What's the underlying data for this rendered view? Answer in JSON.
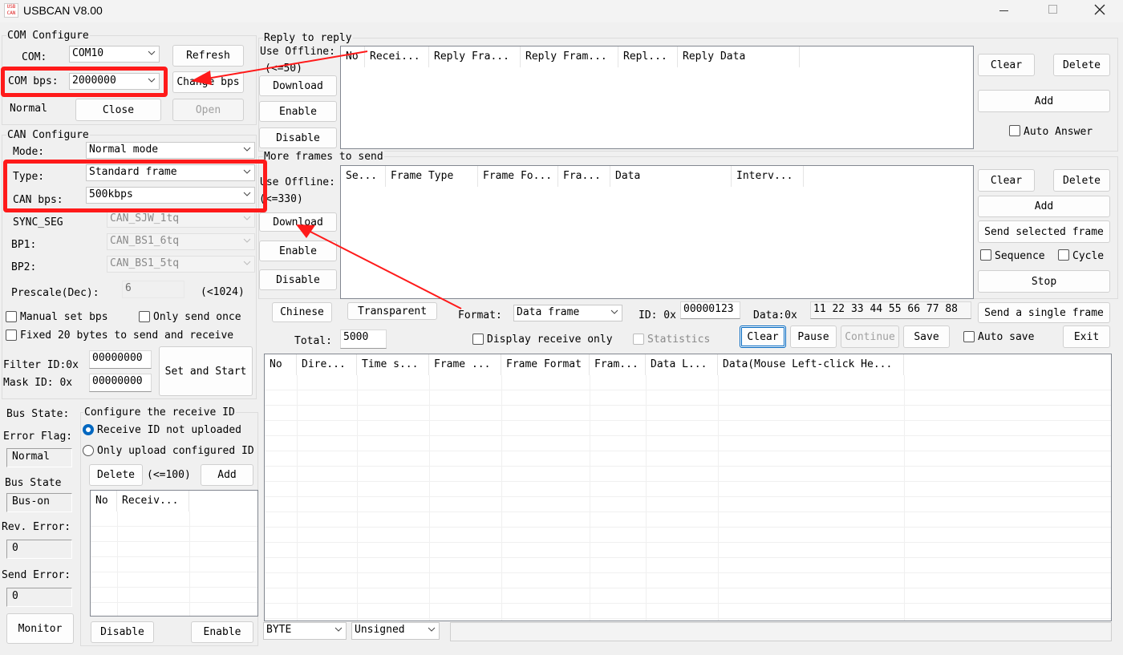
{
  "window": {
    "title": "USBCAN V8.00",
    "logo_text": "USB CAN"
  },
  "com_config": {
    "title": "COM Configure",
    "com_label": "COM:",
    "com_value": "COM10",
    "refresh": "Refresh",
    "bps_label": "COM bps:",
    "bps_value": "2000000",
    "change_bps": "Change bps",
    "status": "Normal",
    "close": "Close",
    "open": "Open"
  },
  "can_config": {
    "title": "CAN Configure",
    "mode_label": "Mode:",
    "mode_value": "Normal mode",
    "type_label": "Type:",
    "type_value": "Standard frame",
    "canbps_label": "CAN bps:",
    "canbps_value": "500kbps",
    "sync_label": "SYNC_SEG",
    "sync_value": "CAN_SJW_1tq",
    "bp1_label": "BP1:",
    "bp1_value": "CAN_BS1_6tq",
    "bp2_label": "BP2:",
    "bp2_value": "CAN_BS1_5tq",
    "prescale_label": "Prescale(Dec):",
    "prescale_value": "6",
    "prescale_limit": "(<1024)",
    "manual_bps": "Manual set bps",
    "send_once": "Only send once",
    "fixed20": "Fixed 20 bytes to send and receive",
    "filter_label": "Filter ID:0x",
    "filter_value": "00000000",
    "mask_label": "Mask ID:  0x",
    "mask_value": "00000000",
    "set_start": "Set and Start"
  },
  "bus": {
    "bus_state_label": "Bus State:",
    "error_flag_label": "Error Flag:",
    "error_flag_value": "Normal",
    "bus_state2_label": "Bus State",
    "bus_state_value": "Bus-on",
    "rev_error_label": "Rev. Error:",
    "rev_error_value": "0",
    "send_error_label": "Send Error:",
    "send_error_value": "0",
    "monitor": "Monitor"
  },
  "recv_id": {
    "title": "Configure the receive ID",
    "opt1": "Receive ID not uploaded",
    "opt2": "Only upload configured ID",
    "delete": "Delete",
    "limit": "(<=100)",
    "add": "Add",
    "col_no": "No",
    "col_recv": "Receiv...",
    "disable": "Disable",
    "enable": "Enable"
  },
  "reply": {
    "title": "Reply to reply",
    "use_offline": "Use Offline:",
    "limit": "(<=50)",
    "download": "Download",
    "enable": "Enable",
    "disable": "Disable",
    "columns": [
      "No",
      "Recei...",
      "Reply Fra...",
      "Reply Fram...",
      "Repl...",
      "Reply Data"
    ],
    "clear": "Clear",
    "delete": "Delete",
    "add": "Add",
    "auto_answer": "Auto Answer"
  },
  "more_frames": {
    "title": "More frames to send",
    "use_offline": "Use Offline:",
    "limit": "(<=330)",
    "download": "Download",
    "enable": "Enable",
    "disable": "Disable",
    "columns": [
      "Se...",
      "Frame Type",
      "Frame Fo...",
      "Fra...",
      "Data",
      "Interv..."
    ],
    "clear": "Clear",
    "delete": "Delete",
    "add": "Add",
    "send_selected": "Send selected frame",
    "sequence": "Sequence",
    "cycle": "Cycle",
    "stop": "Stop"
  },
  "send_bar": {
    "chinese": "Chinese",
    "transparent": "Transparent",
    "format_label": "Format:",
    "format_value": "Data frame",
    "id_label": "ID: 0x",
    "id_value": "00000123",
    "data_label": "Data:0x",
    "data_value": "11 22 33 44 55 66 77 88",
    "send_single": "Send a single frame",
    "total_label": "Total:",
    "total_value": "5000",
    "display_recv_only": "Display receive only",
    "statistics": "Statistics",
    "clear": "Clear",
    "pause": "Pause",
    "continue": "Continue",
    "save": "Save",
    "auto_save": "Auto save",
    "exit": "Exit"
  },
  "recv_table": {
    "columns": [
      "No",
      "Dire...",
      "Time s...",
      "Frame ...",
      "Frame Format",
      "Fram...",
      "Data L...",
      "Data(Mouse Left-click He..."
    ]
  },
  "bottom": {
    "byte_value": "BYTE",
    "sign_value": "Unsigned"
  },
  "colors": {
    "highlight_red": "#ff1a1a",
    "accent_blue": "#0067c0",
    "window_bg": "#f0f0f0"
  }
}
